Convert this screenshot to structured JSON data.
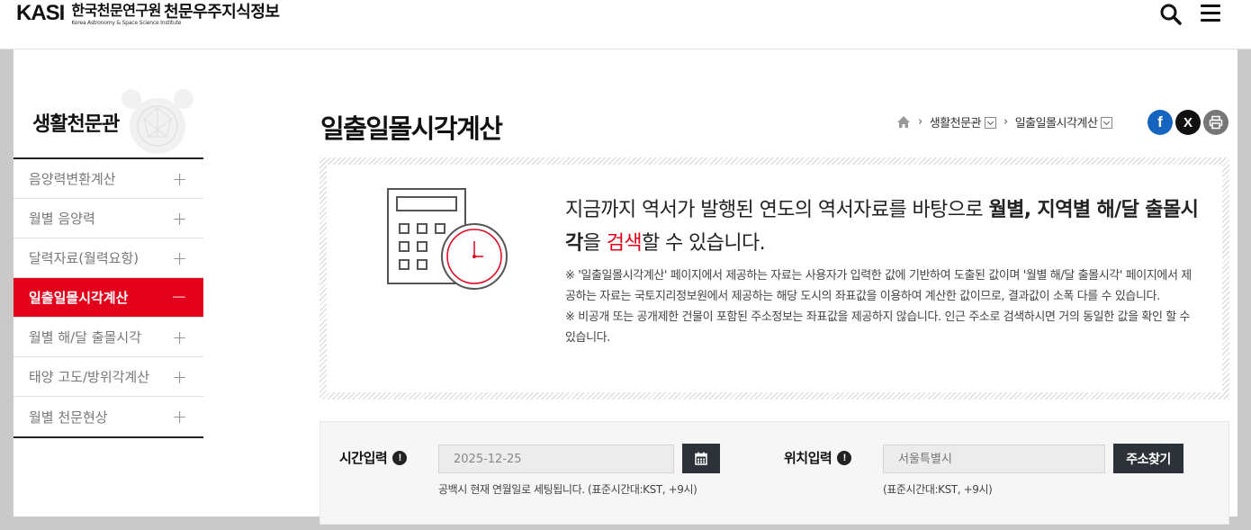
{
  "header": {
    "logo_mark": "KASI",
    "logo_name_ko": "한국천문연구원",
    "logo_name_en": "Korea Astronomy & Space Science Institute",
    "site_title": "천문우주지식정보",
    "icons": {
      "search": "search-icon",
      "menu": "hamburger-menu-icon"
    }
  },
  "sidebar": {
    "title": "생활천문관",
    "items": [
      {
        "label": "음양력변환계산",
        "toggle": "+",
        "active": false
      },
      {
        "label": "월별 음양력",
        "toggle": "+",
        "active": false
      },
      {
        "label": "달력자료(월력요항)",
        "toggle": "+",
        "active": false
      },
      {
        "label": "일출일몰시각계산",
        "toggle": "−",
        "active": true
      },
      {
        "label": "월별 해/달 출몰시각",
        "toggle": "+",
        "active": false
      },
      {
        "label": "태양 고도/방위각계산",
        "toggle": "+",
        "active": false
      },
      {
        "label": "월별 천문현상",
        "toggle": "+",
        "active": false
      }
    ]
  },
  "main": {
    "title": "일출일몰시각계산",
    "breadcrumb": [
      "생활천문관",
      "일출일몰시각계산"
    ],
    "share": {
      "facebook": "f",
      "x": "X"
    }
  },
  "info": {
    "headline_part1": "지금까지 역서가 발행된 연도의 역서자료를 바탕으로 ",
    "headline_bold1": "월별, 지역별 해/달 출몰시각",
    "headline_part2": "을 ",
    "headline_red": "검색",
    "headline_part3": "할 수 있습니다.",
    "note1": "※ '일출일몰시각계산' 페이지에서 제공하는 자료는 사용자가 입력한 값에 기반하여 도출된 값이며 '월별 해/달 출몰시각' 페이지에서 제공하는 자료는 국토지리정보원에서 제공하는 해당 도시의 좌표값을 이용하여 계산한 값이므로, 결과값이 소폭 다를 수 있습니다.",
    "note2": "※ 비공개 또는 공개제한 건물이 포함된 주소정보는 좌표값을 제공하지 않습니다. 인근 주소로 검색하시면 거의 동일한 값을 확인 할 수 있습니다."
  },
  "form": {
    "time_label": "시간입력",
    "time_value": "2025-12-25",
    "time_hint": "공백시 현재 연월일로 세팅됩니다. (표준시간대:KST, +9시)",
    "location_label": "위치입력",
    "location_placeholder": "서울특별시",
    "location_hint": "(표준시간대:KST, +9시)",
    "address_button": "주소찾기",
    "info_glyph": "!"
  },
  "colors": {
    "accent_red": "#e3001b",
    "dark_button": "#2d3238",
    "facebook_blue": "#1565c0"
  }
}
